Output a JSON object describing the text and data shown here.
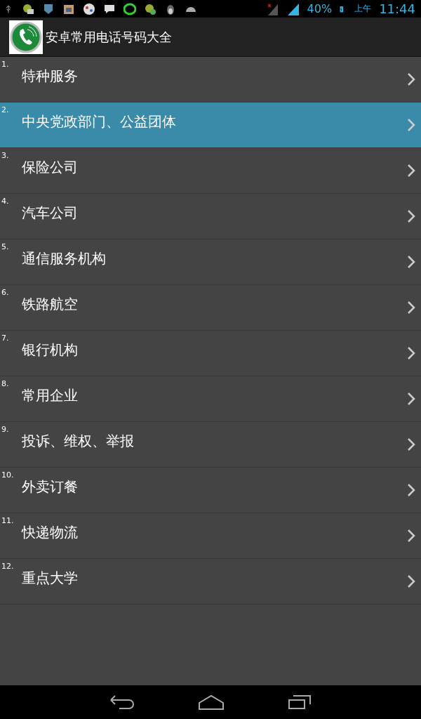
{
  "status_bar": {
    "battery": "40%",
    "am_pm": "上午",
    "time": "11:44"
  },
  "app_bar": {
    "title": "安卓常用电话号码大全"
  },
  "list": [
    {
      "number": "1.",
      "label": "特种服务",
      "selected": false
    },
    {
      "number": "2.",
      "label": "中央党政部门、公益团体",
      "selected": true
    },
    {
      "number": "3.",
      "label": "保险公司",
      "selected": false
    },
    {
      "number": "4.",
      "label": "汽车公司",
      "selected": false
    },
    {
      "number": "5.",
      "label": "通信服务机构",
      "selected": false
    },
    {
      "number": "6.",
      "label": "铁路航空",
      "selected": false
    },
    {
      "number": "7.",
      "label": "银行机构",
      "selected": false
    },
    {
      "number": "8.",
      "label": "常用企业",
      "selected": false
    },
    {
      "number": "9.",
      "label": "投诉、维权、举报",
      "selected": false
    },
    {
      "number": "10.",
      "label": "外卖订餐",
      "selected": false
    },
    {
      "number": "11.",
      "label": "快递物流",
      "selected": false
    },
    {
      "number": "12.",
      "label": "重点大学",
      "selected": false
    }
  ]
}
